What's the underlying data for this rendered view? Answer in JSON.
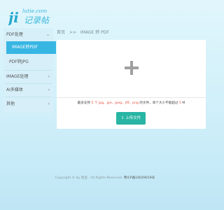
{
  "logo": {
    "letters": "ji",
    "domain": "lutie.com",
    "chinese": "记录帖"
  },
  "sidebar": {
    "pdf_group": {
      "label": "PDF处理"
    },
    "pdf_items": [
      {
        "label": "IMAGE转PDF"
      },
      {
        "label": "PDF转JPG"
      }
    ],
    "image_group": {
      "label": "IMAGE处理"
    },
    "ai_group": {
      "label": "AI多媒体"
    },
    "other_group": {
      "label": "其他"
    },
    "chevron_open": "⌄",
    "chevron_closed": "›"
  },
  "breadcrumb": {
    "home": "首页",
    "sep": ">>",
    "current": "IMAGE 转 PDF"
  },
  "upload": {
    "plus_icon": "plus-icon",
    "info_prefix": "最多支持",
    "max_count": "5",
    "count_unit": "个",
    "formats": "jpg、jpe、jpeg、jfif、png",
    "info_middle": "的文件，单个大小不能超过",
    "max_size": "5",
    "size_unit": "M",
    "button_label": "上传文件",
    "button_icon": "upload-icon"
  },
  "footer": {
    "copyright": "Copyright © by 锐显 . All Rights Reserved.",
    "icp": "粤ICP备16029019号"
  },
  "colors": {
    "accent": "#37b6e3",
    "button": "#28b5a4",
    "highlight": "#e84c3d"
  }
}
